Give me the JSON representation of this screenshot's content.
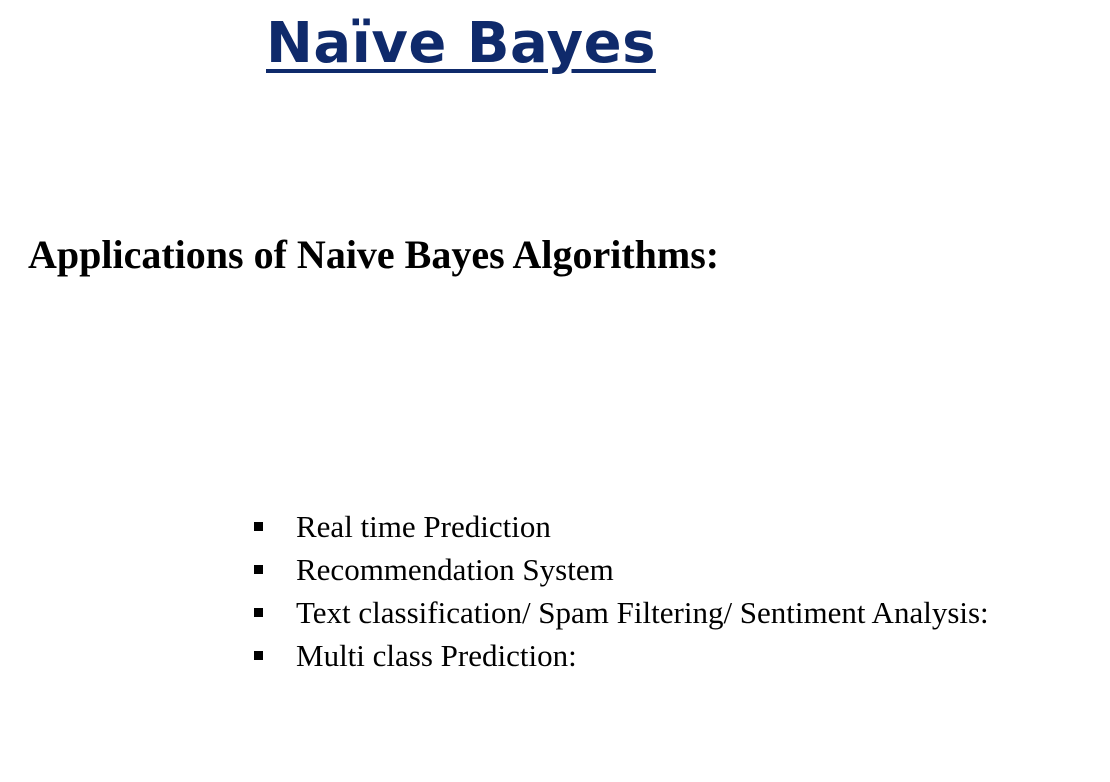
{
  "slide": {
    "title": "Naïve Bayes",
    "subtitle": "Applications of Naive Bayes Algorithms:",
    "bullets": [
      {
        "text": "Real time Prediction"
      },
      {
        "text": "Recommendation System"
      },
      {
        "text": "Text classification/ Spam Filtering/ Sentiment Analysis:"
      },
      {
        "text": "Multi class Prediction:"
      }
    ]
  },
  "colors": {
    "title": "#0f2a6b",
    "text": "#000000",
    "background": "#ffffff"
  }
}
